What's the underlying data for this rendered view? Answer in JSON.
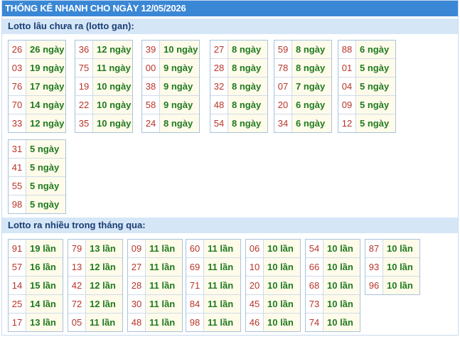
{
  "title": "THỐNG KÊ NHANH CHO NGÀY 12/05/2026",
  "gan": {
    "heading": "Lotto lâu chưa ra (lotto gan):",
    "groups": [
      [
        [
          "26",
          "26 ngày"
        ],
        [
          "03",
          "19 ngày"
        ],
        [
          "76",
          "17 ngày"
        ],
        [
          "70",
          "14 ngày"
        ],
        [
          "33",
          "12 ngày"
        ]
      ],
      [
        [
          "36",
          "12 ngày"
        ],
        [
          "75",
          "11 ngày"
        ],
        [
          "19",
          "10 ngày"
        ],
        [
          "22",
          "10 ngày"
        ],
        [
          "35",
          "10 ngày"
        ]
      ],
      [
        [
          "39",
          "10 ngày"
        ],
        [
          "00",
          "9 ngày"
        ],
        [
          "38",
          "9 ngày"
        ],
        [
          "58",
          "9 ngày"
        ],
        [
          "24",
          "8 ngày"
        ]
      ],
      [
        [
          "27",
          "8 ngày"
        ],
        [
          "28",
          "8 ngày"
        ],
        [
          "32",
          "8 ngày"
        ],
        [
          "48",
          "8 ngày"
        ],
        [
          "54",
          "8 ngày"
        ]
      ],
      [
        [
          "59",
          "8 ngày"
        ],
        [
          "78",
          "8 ngày"
        ],
        [
          "07",
          "7 ngày"
        ],
        [
          "20",
          "6 ngày"
        ],
        [
          "34",
          "6 ngày"
        ]
      ],
      [
        [
          "88",
          "6 ngày"
        ],
        [
          "01",
          "5 ngày"
        ],
        [
          "04",
          "5 ngày"
        ],
        [
          "09",
          "5 ngày"
        ],
        [
          "12",
          "5 ngày"
        ]
      ],
      [
        [
          "31",
          "5 ngày"
        ],
        [
          "41",
          "5 ngày"
        ],
        [
          "55",
          "5 ngày"
        ],
        [
          "98",
          "5 ngày"
        ]
      ]
    ]
  },
  "nhieu": {
    "heading": "Lotto ra nhiều trong tháng qua:",
    "groups": [
      [
        [
          "91",
          "19 lần"
        ],
        [
          "57",
          "16 lần"
        ],
        [
          "14",
          "15 lần"
        ],
        [
          "25",
          "14 lần"
        ],
        [
          "17",
          "13 lần"
        ]
      ],
      [
        [
          "79",
          "13 lần"
        ],
        [
          "13",
          "12 lần"
        ],
        [
          "42",
          "12 lần"
        ],
        [
          "72",
          "12 lần"
        ],
        [
          "05",
          "11 lần"
        ]
      ],
      [
        [
          "09",
          "11 lần"
        ],
        [
          "27",
          "11 lần"
        ],
        [
          "28",
          "11 lần"
        ],
        [
          "30",
          "11 lần"
        ],
        [
          "48",
          "11 lần"
        ]
      ],
      [
        [
          "60",
          "11 lần"
        ],
        [
          "69",
          "11 lần"
        ],
        [
          "71",
          "11 lần"
        ],
        [
          "84",
          "11 lần"
        ],
        [
          "98",
          "11 lần"
        ]
      ],
      [
        [
          "06",
          "10 lần"
        ],
        [
          "10",
          "10 lần"
        ],
        [
          "20",
          "10 lần"
        ],
        [
          "45",
          "10 lần"
        ],
        [
          "46",
          "10 lần"
        ]
      ],
      [
        [
          "54",
          "10 lần"
        ],
        [
          "66",
          "10 lần"
        ],
        [
          "68",
          "10 lần"
        ],
        [
          "73",
          "10 lần"
        ],
        [
          "74",
          "10 lần"
        ]
      ],
      [
        [
          "87",
          "10 lần"
        ],
        [
          "93",
          "10 lần"
        ],
        [
          "96",
          "10 lần"
        ]
      ]
    ]
  }
}
